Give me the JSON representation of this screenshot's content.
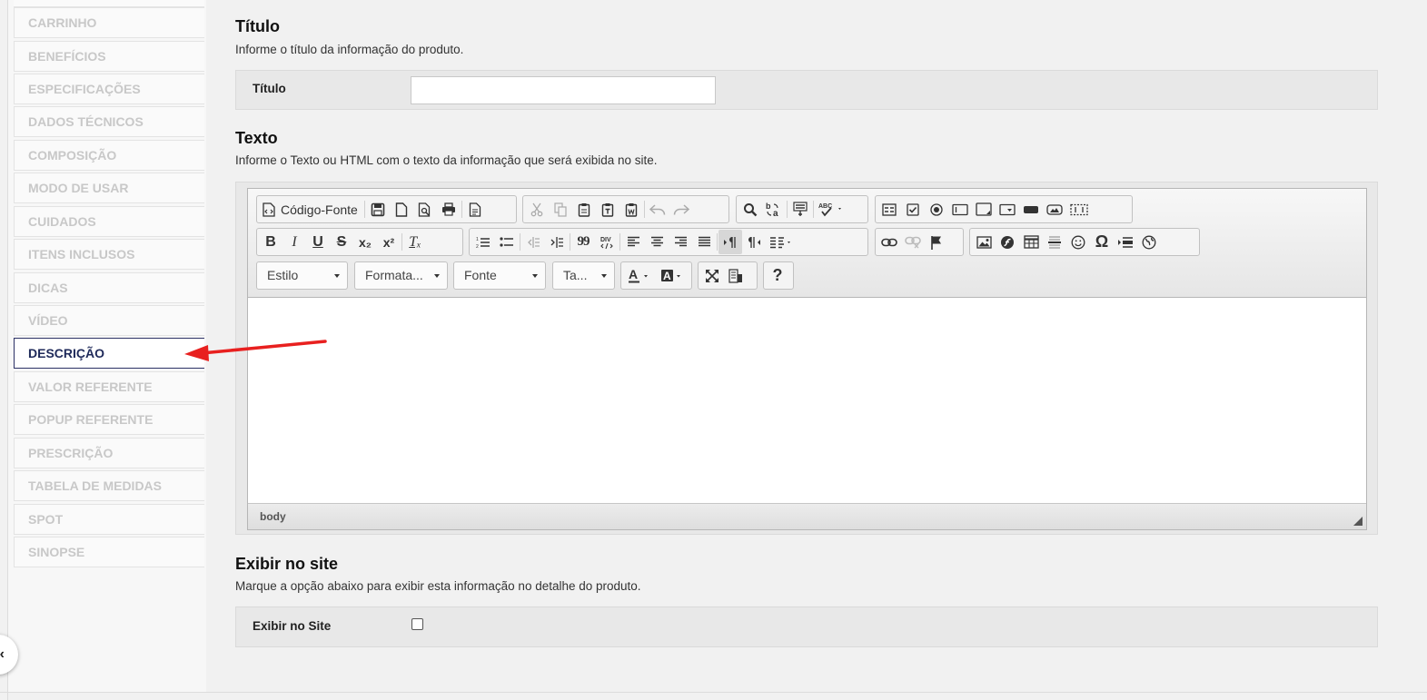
{
  "sidebar": {
    "items": [
      {
        "label": "CARRINHO",
        "active": false
      },
      {
        "label": "BENEFÍCIOS",
        "active": false
      },
      {
        "label": "ESPECIFICAÇÕES",
        "active": false
      },
      {
        "label": "DADOS TÉCNICOS",
        "active": false
      },
      {
        "label": "COMPOSIÇÃO",
        "active": false
      },
      {
        "label": "MODO DE USAR",
        "active": false
      },
      {
        "label": "CUIDADOS",
        "active": false
      },
      {
        "label": "ITENS INCLUSOS",
        "active": false
      },
      {
        "label": "DICAS",
        "active": false
      },
      {
        "label": "VÍDEO",
        "active": false
      },
      {
        "label": "DESCRIÇÃO",
        "active": true
      },
      {
        "label": "VALOR REFERENTE",
        "active": false
      },
      {
        "label": "POPUP REFERENTE",
        "active": false
      },
      {
        "label": "PRESCRIÇÃO",
        "active": false
      },
      {
        "label": "TABELA DE MEDIDAS",
        "active": false
      },
      {
        "label": "SPOT",
        "active": false
      },
      {
        "label": "SINOPSE",
        "active": false
      }
    ],
    "collapse_glyph": "‹"
  },
  "titulo_section": {
    "title": "Título",
    "description": "Informe o título da informação do produto.",
    "field_label": "Título",
    "value": "",
    "placeholder": ""
  },
  "texto_section": {
    "title": "Texto",
    "description": "Informe o Texto ou HTML com o texto da informação que será exibida no site."
  },
  "editor": {
    "source_button": "Código-Fonte",
    "combos": {
      "style": "Estilo",
      "format": "Formata...",
      "font": "Fonte",
      "size": "Ta..."
    },
    "bold": "B",
    "italic": "I",
    "underline": "U",
    "strike": "S",
    "subscript": "x₂",
    "superscript": "x²",
    "remove_format": "Tₓ",
    "blockquote": "99",
    "div": "DIV",
    "help": "?",
    "status_path": "body",
    "content": ""
  },
  "exibir_section": {
    "title": "Exibir no site",
    "description": "Marque a opção abaixo para exibir esta informação no detalhe do produto.",
    "field_label": "Exibir no Site",
    "checked": false
  },
  "colors": {
    "active_border": "#2c3165",
    "annotation_arrow": "#e8201f"
  }
}
